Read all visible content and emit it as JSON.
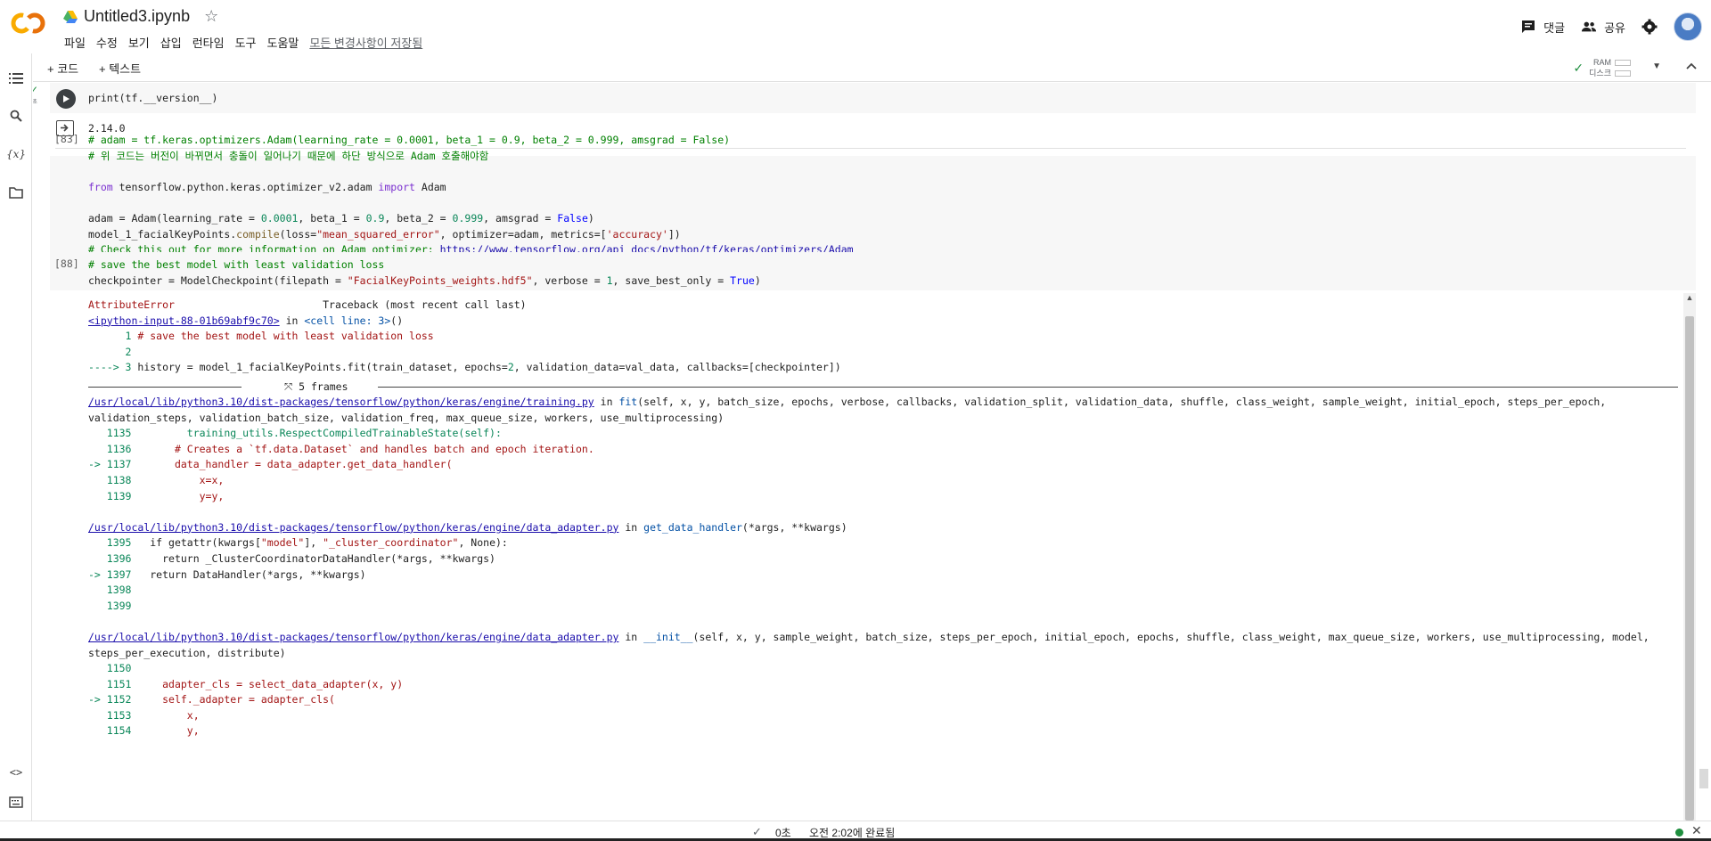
{
  "header": {
    "file_name": "Untitled3.ipynb",
    "menus": [
      "파일",
      "수정",
      "보기",
      "삽입",
      "런타임",
      "도구",
      "도움말"
    ],
    "save_status": "모든 변경사항이 저장됨",
    "comment_label": "댓글",
    "share_label": "공유"
  },
  "toolbar": {
    "add_code": "+ 코드",
    "add_text": "+ 텍스트",
    "ram_label": "RAM",
    "disk_label": "디스크"
  },
  "cells": {
    "cell1": {
      "exec_time": "0초",
      "code": "print(tf.__version__)",
      "output": "2.14.0"
    },
    "cell2": {
      "count": "[83]",
      "line1": "# adam = tf.keras.optimizers.Adam(learning_rate = 0.0001, beta_1 = 0.9, beta_2 = 0.999, amsgrad = False)",
      "line2": "# 위 코드는 버전이 바뀌면서 충돌이 일어나기 때문에 하단 방식으로 Adam 호출해야함",
      "line3_kw": "from",
      "line3_mid": " tensorflow.python.keras.optimizer_v2.adam ",
      "line3_kw2": "import",
      "line3_end": " Adam",
      "line4_a": "adam = Adam(learning_rate = ",
      "line4_n1": "0.0001",
      "line4_b": ", beta_1 = ",
      "line4_n2": "0.9",
      "line4_c": ", beta_2 = ",
      "line4_n3": "0.999",
      "line4_d": ", amsgrad = ",
      "line4_kw": "False",
      "line4_e": ")",
      "line5_a": "model_1_facialKeyPoints.",
      "line5_fn": "compile",
      "line5_b": "(loss=",
      "line5_s1": "\"mean_squared_error\"",
      "line5_c": ", optimizer=adam, metrics=[",
      "line5_s2": "'accuracy'",
      "line5_d": "])",
      "line6_cm": "# Check this out for more information on Adam optimizer: ",
      "line6_link": "https://www.tensorflow.org/api_docs/python/tf/keras/optimizers/Adam"
    },
    "cell3": {
      "count": "[88]",
      "line1": "# save the best model with least validation loss",
      "line2_a": "checkpointer = ModelCheckpoint(filepath = ",
      "line2_s": "\"FacialKeyPoints_weights.hdf5\"",
      "line2_b": ", verbose = ",
      "line2_n": "1",
      "line2_c": ", save_best_only = ",
      "line2_kw": "True",
      "line2_d": ")"
    }
  },
  "traceback": {
    "error_name": "AttributeError",
    "header_right": "Traceback (most recent call last)",
    "input_link": "<ipython-input-88-01b69abf9c70>",
    "in_word": " in ",
    "cell_line": "<cell line: 3>",
    "cell_line_tail": "()",
    "l1_num": "      1 ",
    "l1_text": "# save the best model with least validation loss",
    "l2_num": "      2",
    "l3_arrow": "----> 3 ",
    "l3_a": "history = model_1_facialKeyPoints.fit(train_dataset, epochs=",
    "l3_n": "2",
    "l3_b": ", validation_data=val_data, callbacks=[checkpointer])",
    "frames_label": "5 frames",
    "f1_path": "/usr/local/lib/python3.10/dist-packages/tensorflow/python/keras/engine/training.py",
    "f1_in": " in ",
    "f1_fn": "fit",
    "f1_sig": "(self, x, y, batch_size, epochs, verbose, callbacks, validation_split, validation_data, shuffle, class_weight, sample_weight, initial_epoch, steps_per_epoch,",
    "f1_sig2": "validation_steps, validation_batch_size, validation_freq, max_queue_size, workers, use_multiprocessing)",
    "f1_l1": "   1135         training_utils.RespectCompiledTrainableState(self):",
    "f1_l2_num": "   1136       ",
    "f1_l2": "# Creates a `tf.data.Dataset` and handles batch and epoch iteration.",
    "f1_l3_arrow": "-> 1137       ",
    "f1_l3": "data_handler = data_adapter.get_data_handler(",
    "f1_l4_num": "   1138           ",
    "f1_l4": "x=x,",
    "f1_l5_num": "   1139           ",
    "f1_l5": "y=y,",
    "f2_path": "/usr/local/lib/python3.10/dist-packages/tensorflow/python/keras/engine/data_adapter.py",
    "f2_in": " in ",
    "f2_fn": "get_data_handler",
    "f2_sig": "(*args, **kwargs)",
    "f2_l1_num": "   1395   ",
    "f2_l1_a": "if getattr(kwargs[",
    "f2_l1_s1": "\"model\"",
    "f2_l1_b": "], ",
    "f2_l1_s2": "\"_cluster_coordinator\"",
    "f2_l1_c": ", None):",
    "f2_l2_num": "   1396     ",
    "f2_l2": "return _ClusterCoordinatorDataHandler(*args, **kwargs)",
    "f2_l3_arrow": "-> 1397   ",
    "f2_l3": "return DataHandler(*args, **kwargs)",
    "f2_l4": "   1398",
    "f2_l5": "   1399",
    "f3_path": "/usr/local/lib/python3.10/dist-packages/tensorflow/python/keras/engine/data_adapter.py",
    "f3_in": " in ",
    "f3_fn": "__init__",
    "f3_sig": "(self, x, y, sample_weight, batch_size, steps_per_epoch, initial_epoch, epochs, shuffle, class_weight, max_queue_size, workers, use_multiprocessing, model,",
    "f3_sig2": "steps_per_execution, distribute)",
    "f3_l1": "   1150",
    "f3_l2_num": "   1151     ",
    "f3_l2": "adapter_cls = select_data_adapter(x, y)",
    "f3_l3_arrow": "-> 1152     ",
    "f3_l3": "self._adapter = adapter_cls(",
    "f3_l4_num": "   1153         ",
    "f3_l4": "x,",
    "f3_l5_num": "   1154         ",
    "f3_l5": "y,"
  },
  "statusbar": {
    "check": "✓",
    "elapsed": "0초",
    "completed": "오전 2:02에 완료됨"
  }
}
